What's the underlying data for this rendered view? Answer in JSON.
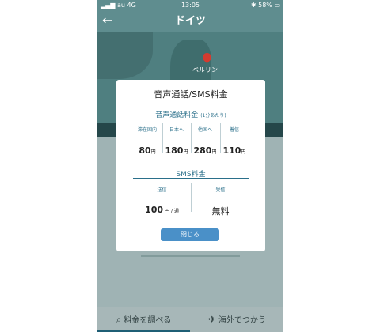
{
  "status": {
    "carrier": "au",
    "network": "4G",
    "time": "13:05",
    "battery": "58%"
  },
  "nav": {
    "back_label": "←",
    "title": "ドイツ"
  },
  "map": {
    "city": "ベルリン"
  },
  "modal": {
    "title": "音声通話/SMS料金",
    "voice": {
      "title": "音声通話料金",
      "note": "(1分あたり)",
      "columns": [
        {
          "label": "滞在国内",
          "value": "80",
          "unit": "円"
        },
        {
          "label": "日本へ",
          "value": "180",
          "unit": "円"
        },
        {
          "label": "他国へ",
          "value": "280",
          "unit": "円"
        },
        {
          "label": "着信",
          "value": "110",
          "unit": "円"
        }
      ]
    },
    "sms": {
      "title": "SMS料金",
      "send": {
        "label": "送信",
        "value": "100",
        "unit": "円 / 通"
      },
      "receive": {
        "label": "受信",
        "value": "無料"
      }
    },
    "close_label": "閉じる"
  },
  "tabs": [
    {
      "label": "料金を調べる",
      "icon": "search-icon"
    },
    {
      "label": "海外でつかう",
      "icon": "airplane-icon"
    }
  ]
}
